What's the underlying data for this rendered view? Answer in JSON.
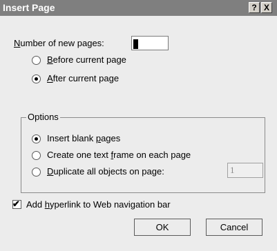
{
  "window": {
    "title": "Insert Page",
    "help": "?",
    "close": "X"
  },
  "count": {
    "label_pre": "",
    "label_u": "N",
    "label_post": "umber of new pages:",
    "value": "1"
  },
  "position_options": [
    {
      "u": "B",
      "rest": "efore current page",
      "selected": false
    },
    {
      "u": "A",
      "rest": "fter current page",
      "selected": true
    }
  ],
  "options": {
    "title": "Options",
    "items": [
      {
        "pre": "Insert blank ",
        "u": "p",
        "rest": "ages",
        "selected": true
      },
      {
        "pre": "Create one text ",
        "u": "f",
        "rest": "rame on each page",
        "selected": false
      },
      {
        "pre": "",
        "u": "D",
        "rest": "uplicate all objects on page:",
        "selected": false
      }
    ],
    "duplicate_page_value": "1"
  },
  "hyperlink": {
    "pre": "Add ",
    "u": "h",
    "rest": "yperlink to Web navigation bar",
    "checked": true
  },
  "buttons": {
    "ok": "OK",
    "cancel": "Cancel"
  }
}
